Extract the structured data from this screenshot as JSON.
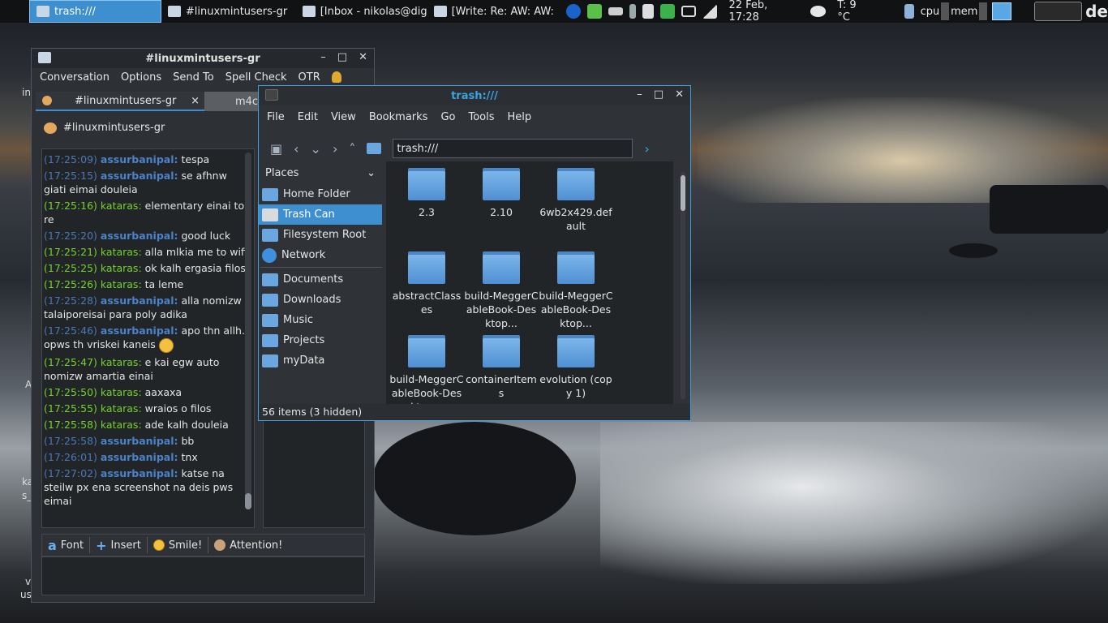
{
  "taskbar": {
    "tasks": [
      {
        "label": "trash:///"
      },
      {
        "label": "#linuxmintusers-gr"
      },
      {
        "label": "[Inbox - nikolas@dig..."
      },
      {
        "label": "[Write: Re: AW: AW: ..."
      }
    ],
    "clock": "22 Feb, 17:28",
    "temperature": "T: 9 °C",
    "cpu_label": "cpu",
    "mem_label": "mem",
    "corner_text": "de"
  },
  "chat": {
    "title": "#linuxmintusers-gr",
    "menu": [
      "Conversation",
      "Options",
      "Send To",
      "Spell Check",
      "OTR"
    ],
    "tab_label": "#linuxmintusers-gr",
    "tab_close": "×",
    "second_tab_label": "m4c",
    "room_title": "#linuxmintusers-gr",
    "messages": [
      {
        "time": "(17:25:09)",
        "nick": "assurbanipal:",
        "text": "tespa",
        "kind": "a"
      },
      {
        "time": "(17:25:15)",
        "nick": "assurbanipal:",
        "text": "se afhnw giati eimai douleia",
        "kind": "a"
      },
      {
        "time": "(17:25:16)",
        "nick": "kataras:",
        "text": "elementary einai top re",
        "kind": "k"
      },
      {
        "time": "(17:25:20)",
        "nick": "assurbanipal:",
        "text": "good luck",
        "kind": "a"
      },
      {
        "time": "(17:25:21)",
        "nick": "kataras:",
        "text": "alla mlkia me to wifi",
        "kind": "k"
      },
      {
        "time": "(17:25:25)",
        "nick": "kataras:",
        "text": "ok kalh ergasia filos",
        "kind": "k"
      },
      {
        "time": "(17:25:26)",
        "nick": "kataras:",
        "text": "ta leme",
        "kind": "k"
      },
      {
        "time": "(17:25:28)",
        "nick": "assurbanipal:",
        "text": "alla nomizw talaiporeisai para poly adika",
        "kind": "a"
      },
      {
        "time": "(17:25:46)",
        "nick": "assurbanipal:",
        "text": "apo thn allh... opws th vriskei kaneis",
        "kind": "a"
      },
      {
        "time": "(17:25:47)",
        "nick": "kataras:",
        "text": "e kai egw auto nomizw amartia einai",
        "kind": "k"
      },
      {
        "time": "(17:25:50)",
        "nick": "kataras:",
        "text": "aaxaxa",
        "kind": "k"
      },
      {
        "time": "(17:25:55)",
        "nick": "kataras:",
        "text": "wraios o filos",
        "kind": "k"
      },
      {
        "time": "(17:25:58)",
        "nick": "kataras:",
        "text": "ade kalh douleia",
        "kind": "k"
      },
      {
        "time": "(17:25:58)",
        "nick": "assurbanipal:",
        "text": "bb",
        "kind": "a"
      },
      {
        "time": "(17:26:01)",
        "nick": "assurbanipal:",
        "text": "tnx",
        "kind": "a"
      },
      {
        "time": "(17:27:02)",
        "nick": "assurbanipal:",
        "text": "katse na steilw px ena screenshot na deis pws eimai",
        "kind": "a"
      }
    ],
    "format_bar": {
      "font": "Font",
      "insert": "Insert",
      "smile": "Smile!",
      "attention": "Attention!"
    },
    "side_fragments": {
      "a": "in",
      "b": "A",
      "c": "ka",
      "d": "s_",
      "e": "v",
      "f": "us"
    }
  },
  "filemanager": {
    "title": "trash:///",
    "menu": [
      "File",
      "Edit",
      "View",
      "Bookmarks",
      "Go",
      "Tools",
      "Help"
    ],
    "address": "trash:///",
    "places_header": "Places",
    "places": [
      {
        "label": "Home Folder",
        "selected": false
      },
      {
        "label": "Trash Can",
        "selected": true
      },
      {
        "label": "Filesystem Root",
        "selected": false
      },
      {
        "label": "Network",
        "selected": false
      }
    ],
    "bookmarks": [
      {
        "label": "Documents"
      },
      {
        "label": "Downloads"
      },
      {
        "label": "Music"
      },
      {
        "label": "Projects"
      },
      {
        "label": "myData"
      }
    ],
    "files": [
      {
        "name": "2.3"
      },
      {
        "name": "2.10"
      },
      {
        "name": "6wb2x429.default"
      },
      {
        "name": "abstractClasses"
      },
      {
        "name": "build-MeggerCableBook-Desktop..."
      },
      {
        "name": "build-MeggerCableBook-Desktop..."
      },
      {
        "name": "build-MeggerCableBook-Desktop..."
      },
      {
        "name": "containerItems"
      },
      {
        "name": "evolution (copy 1)"
      }
    ],
    "status": "56 items (3 hidden)"
  },
  "colors": {
    "accent": "#3d8fd0",
    "nick_a": "#4b82c8",
    "nick_k": "#74d12c"
  }
}
